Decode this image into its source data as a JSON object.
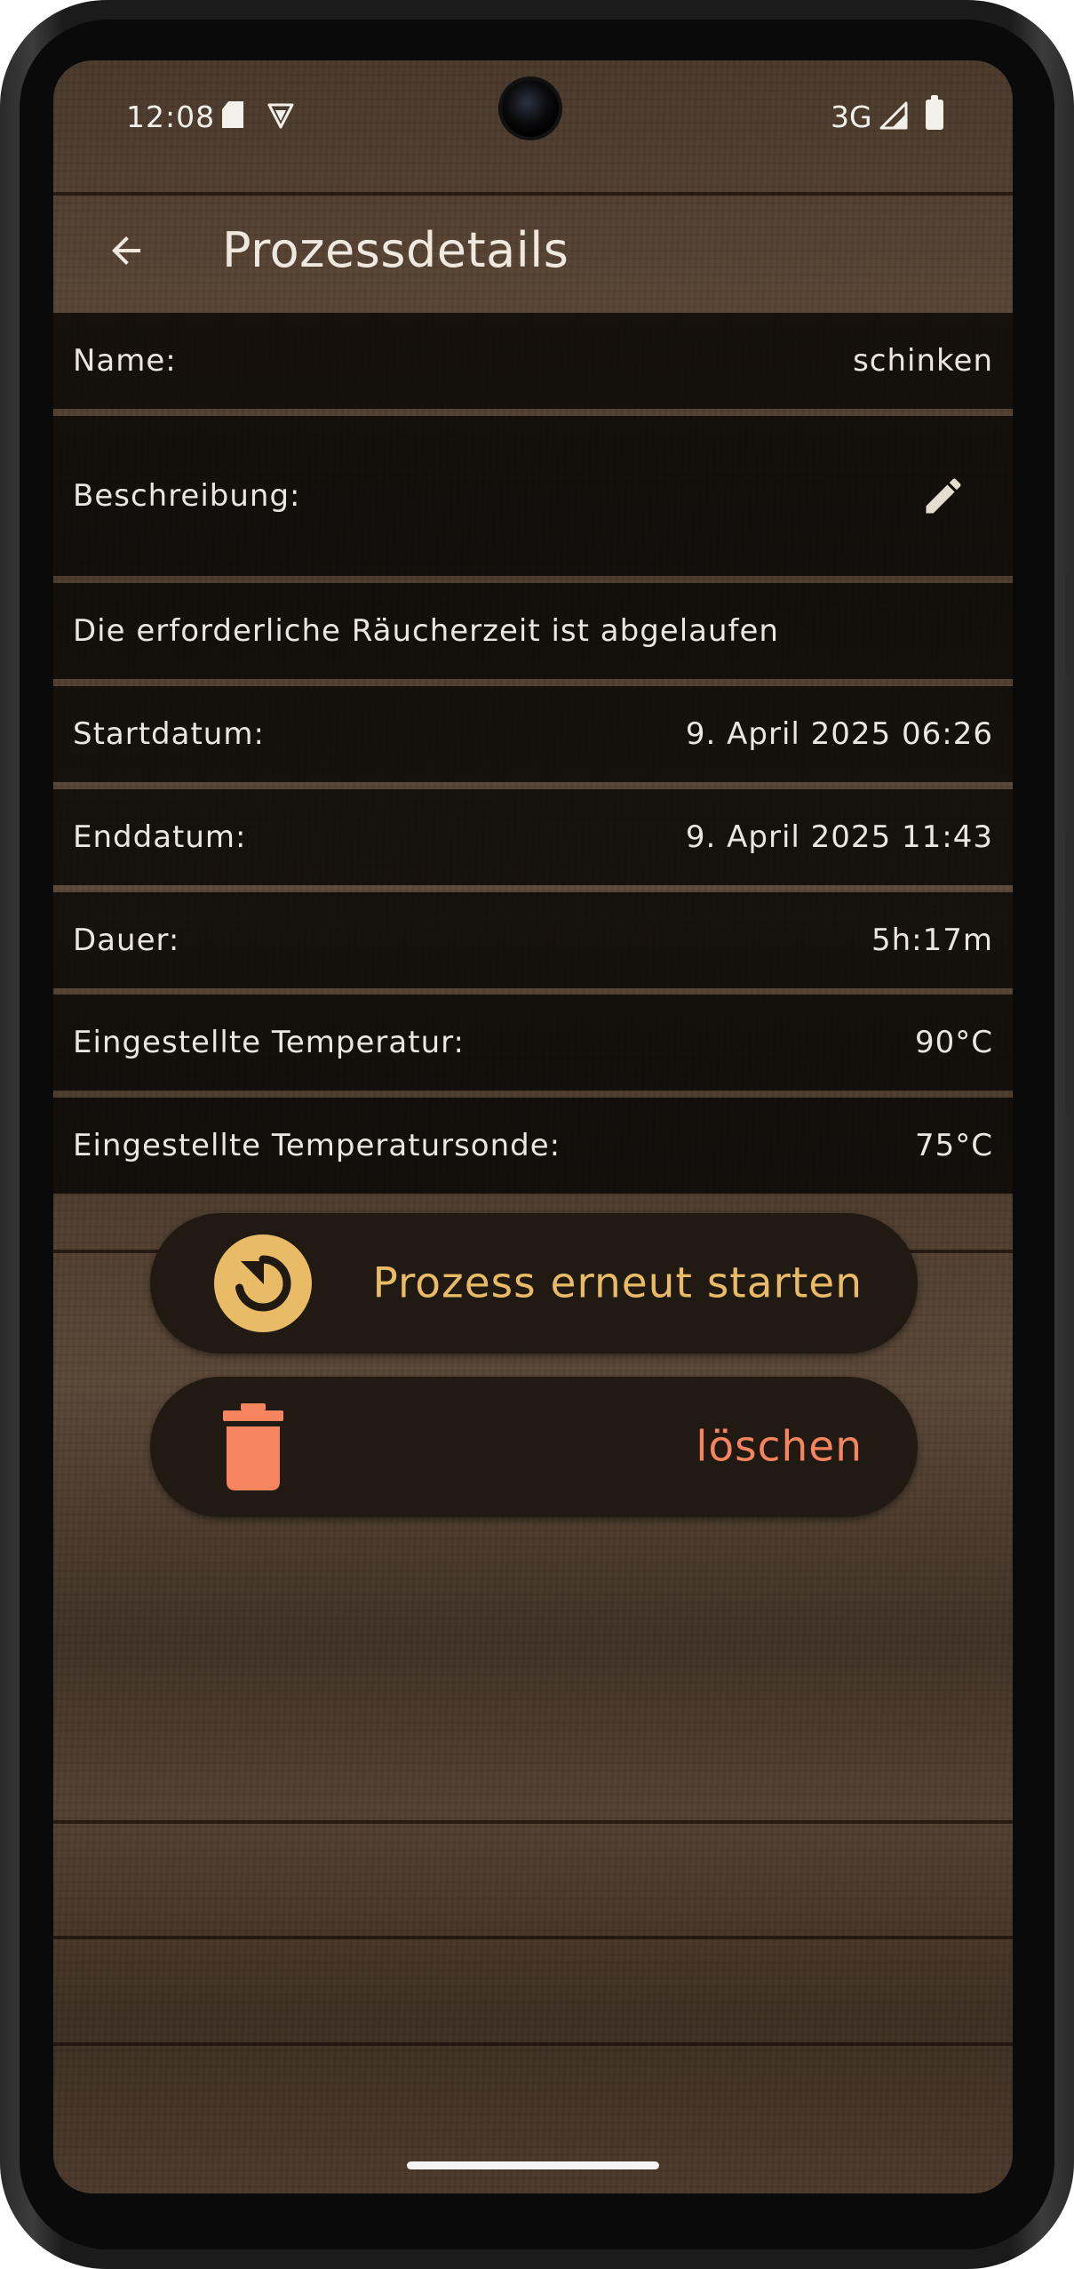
{
  "status_bar": {
    "time": "12:08",
    "network": "3G",
    "icons": [
      "sd-card-icon",
      "vpn-icon",
      "signal-icon",
      "battery-icon"
    ]
  },
  "app_bar": {
    "title": "Prozessdetails",
    "back_icon": "arrow-back-icon"
  },
  "details": {
    "name_label": "Name:",
    "name_value": "schinken",
    "description_label": "Beschreibung:",
    "description_text": "Die erforderliche Räucherzeit ist abgelaufen",
    "start_label": "Startdatum:",
    "start_value": "9. April 2025 06:26",
    "end_label": "Enddatum:",
    "end_value": "9. April 2025 11:43",
    "duration_label": "Dauer:",
    "duration_value": "5h:17m",
    "temp_label": "Eingestellte Temperatur:",
    "temp_value": "90°C",
    "probe_label": "Eingestellte Temperatursonde:",
    "probe_value": "75°C"
  },
  "actions": {
    "restart_label": "Prozess erneut starten",
    "delete_label": "löschen"
  },
  "colors": {
    "restart_accent": "#e9bb66",
    "delete_accent": "#f5845f",
    "button_bg": "#201a13"
  }
}
